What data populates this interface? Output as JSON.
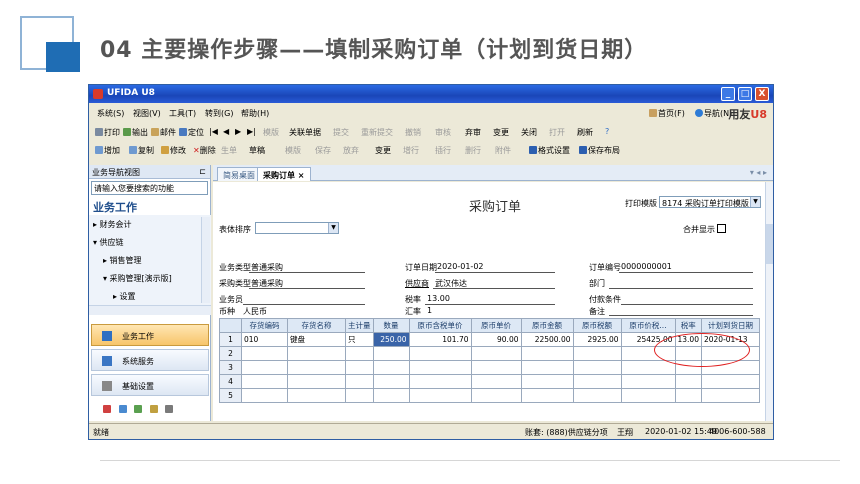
{
  "slide": {
    "title": "04  主要操作步骤——填制采购订单（计划到货日期）"
  },
  "window": {
    "title": "UFIDA U8",
    "min_label": "_",
    "max_label": "□",
    "close_label": "X"
  },
  "menubar": {
    "items": [
      "系统(S)",
      "视图(V)",
      "工具(T)",
      "转到(G)",
      "帮助(H)"
    ],
    "home": "首页(F)",
    "nav": "导航(N)",
    "brand": "用友",
    "brand_mark": "U8"
  },
  "toolbar1": [
    "打印",
    "输出",
    "邮件",
    "定位",
    "|◀",
    "◀",
    "▶",
    "▶|",
    "模版",
    "关联单据",
    "提交",
    "重新提交",
    "撤销",
    "审核",
    "弃审",
    "变更",
    "关闭",
    "打开",
    "刷新",
    "?"
  ],
  "toolbar2": [
    "增加",
    "复制",
    "修改",
    "删除",
    "生单",
    "草稿",
    "模版",
    "保存",
    "放弃",
    "变更",
    "增行",
    "插行",
    "删行",
    "附件",
    "格式设置",
    "保存布局"
  ],
  "nav": {
    "header": "业务导航视图",
    "pin": "⊏",
    "search_placeholder": "请输入您要搜索的功能",
    "section": "业务工作",
    "tree": [
      "▸ 财务会计",
      "▾ 供应链",
      "▸ 销售管理",
      "▾ 采购管理[演示版]",
      "▸ 设置"
    ],
    "btn_work": "业务工作",
    "btn_service": "系统服务",
    "btn_settings": "基础设置"
  },
  "tabs": {
    "items": [
      "简易桌面",
      "采购订单"
    ],
    "close": "×",
    "arrows": "▾ ◂ ▸"
  },
  "form": {
    "title": "采购订单",
    "print_template_label": "打印模版",
    "print_template_value": "8174 采购订单打印模版",
    "sort_label": "表体排序",
    "merge_label": "合并显示",
    "fields": {
      "biz_type_label": "业务类型",
      "biz_type_value": "普通采购",
      "order_date_label": "订单日期",
      "order_date_value": "2020-01-02",
      "order_no_label": "订单编号",
      "order_no_value": "0000000001",
      "purch_type_label": "采购类型",
      "purch_type_value": "普通采购",
      "supplier_label": "供应商",
      "supplier_value": "武汉伟达",
      "dept_label": "部门",
      "salesman_label": "业务员",
      "tax_rate_label": "税率",
      "tax_rate_value": "13.00",
      "pay_terms_label": "付款条件",
      "currency_label": "币种",
      "currency_value": "人民币",
      "exch_rate_label": "汇率",
      "exch_rate_value": "1",
      "note_label": "备注"
    },
    "grid": {
      "headers": [
        "存货编码",
        "存货名称",
        "主计量",
        "数量",
        "原币含税单价",
        "原币单价",
        "原币金额",
        "原币税额",
        "原币价税...",
        "税率",
        "计划到货日期"
      ],
      "rows": [
        [
          "1",
          "010",
          "键盘",
          "只",
          "250.00",
          "101.70",
          "90.00",
          "22500.00",
          "2925.00",
          "25425.00",
          "13.00",
          "2020-01-13"
        ],
        [
          "2",
          "",
          "",
          "",
          "",
          "",
          "",
          "",
          "",
          "",
          "",
          ""
        ],
        [
          "3",
          "",
          "",
          "",
          "",
          "",
          "",
          "",
          "",
          "",
          "",
          ""
        ],
        [
          "4",
          "",
          "",
          "",
          "",
          "",
          "",
          "",
          "",
          "",
          "",
          ""
        ],
        [
          "5",
          "",
          "",
          "",
          "",
          "",
          "",
          "",
          "",
          "",
          "",
          ""
        ]
      ]
    }
  },
  "statusbar": {
    "ready": "就绪",
    "account": "账套: (888)供应链分项",
    "user": "王翔",
    "datetime": "2020-01-02 15:49",
    "phone": "4006-600-588"
  }
}
